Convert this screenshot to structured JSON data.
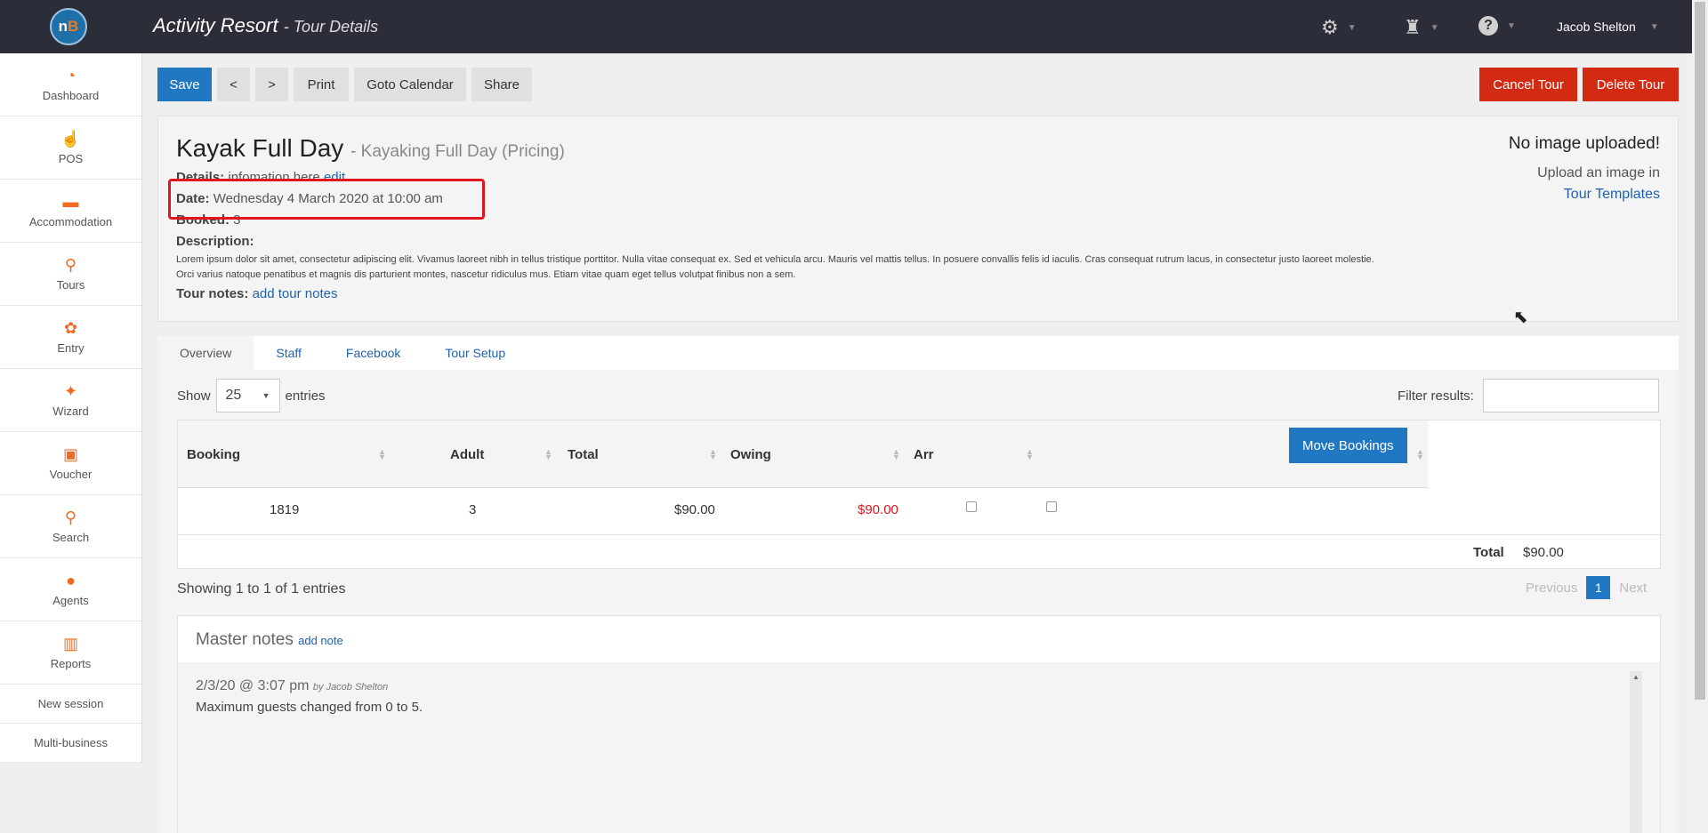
{
  "header": {
    "logo_n": "n",
    "logo_b": "B",
    "app_name": "Activity Resort",
    "page_subtitle": "- Tour Details",
    "settings_icon": "gear-icon",
    "agent_icon": "agent-icon",
    "help_icon": "help-icon",
    "user_name": "Jacob Shelton"
  },
  "sidebar": {
    "items": [
      {
        "label": "Dashboard",
        "icon": "dashboard-icon",
        "glyph": "◔"
      },
      {
        "label": "POS",
        "icon": "hand-pointer-icon",
        "glyph": "☝"
      },
      {
        "label": "Accommodation",
        "icon": "bed-icon",
        "glyph": "▬"
      },
      {
        "label": "Tours",
        "icon": "route-icon",
        "glyph": "⚲"
      },
      {
        "label": "Entry",
        "icon": "lotus-icon",
        "glyph": "✿"
      },
      {
        "label": "Wizard",
        "icon": "magic-wand-icon",
        "glyph": "✦"
      },
      {
        "label": "Voucher",
        "icon": "gift-icon",
        "glyph": "▣"
      },
      {
        "label": "Search",
        "icon": "search-icon",
        "glyph": "⚲"
      },
      {
        "label": "Agents",
        "icon": "user-icon",
        "glyph": "●"
      },
      {
        "label": "Reports",
        "icon": "bar-chart-icon",
        "glyph": "▥"
      }
    ],
    "links": [
      "New session",
      "Multi-business"
    ]
  },
  "toolbar": {
    "save": "Save",
    "prev": "<",
    "next": ">",
    "print": "Print",
    "goto_calendar": "Goto Calendar",
    "share": "Share",
    "cancel_tour": "Cancel Tour",
    "delete_tour": "Delete Tour"
  },
  "tour": {
    "name": "Kayak Full Day",
    "pricing": "- Kayaking Full Day (Pricing)",
    "details_label": "Details:",
    "details_value": "infomation here",
    "details_edit": "edit",
    "date_label": "Date:",
    "date_value": "Wednesday 4 March 2020 at 10:00 am",
    "booked_label": "Booked:",
    "booked_value": "3",
    "description_label": "Description:",
    "description_line1": "Lorem ipsum dolor sit amet, consectetur adipiscing elit. Vivamus laoreet nibh in tellus tristique porttitor. Nulla vitae consequat ex. Sed et vehicula arcu. Mauris vel mattis tellus. In posuere convallis felis id iaculis. Cras consequat rutrum lacus, in consectetur justo laoreet molestie.",
    "description_line2": "Orci varius natoque penatibus et magnis dis parturient montes, nascetur ridiculus mus. Etiam vitae quam eget tellus volutpat finibus non a sem.",
    "tour_notes_label": "Tour notes:",
    "tour_notes_link": "add tour notes",
    "no_image": "No image uploaded!",
    "upload_hint": "Upload an image in",
    "upload_link": "Tour Templates"
  },
  "tabs": [
    "Overview",
    "Staff",
    "Facebook",
    "Tour Setup"
  ],
  "table": {
    "show_label": "Show",
    "page_size": "25",
    "entries_label": "entries",
    "filter_label": "Filter results:",
    "columns": [
      "Booking",
      "Adult",
      "Total",
      "Owing",
      "Arr"
    ],
    "move_bookings": "Move Bookings",
    "rows": [
      {
        "booking": "1819",
        "adult": "3",
        "total": "$90.00",
        "owing": "$90.00"
      }
    ],
    "total_label": "Total",
    "total_value": "$90.00",
    "showing": "Showing 1 to 1 of 1 entries",
    "previous": "Previous",
    "page": "1",
    "next": "Next"
  },
  "notes": {
    "title": "Master notes",
    "add_note": "add note",
    "entries": [
      {
        "date": "2/3/20 @ 3:07 pm",
        "by": "by Jacob Shelton",
        "text": "Maximum guests changed from 0 to 5."
      }
    ]
  },
  "colors": {
    "topbar": "#2b2e39",
    "accent_orange": "#ef6b22",
    "primary_blue": "#1f78c1",
    "danger_red": "#d22a13",
    "owing_red": "#e0161f",
    "highlight_box": "#e0161f"
  }
}
